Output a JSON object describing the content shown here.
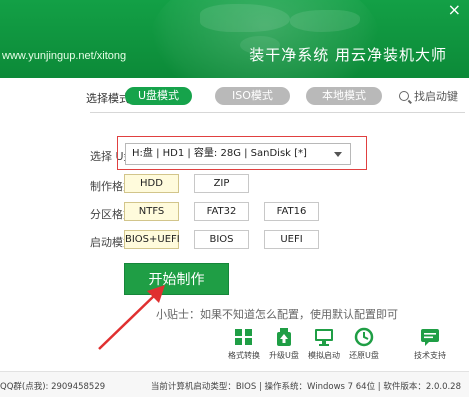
{
  "header": {
    "url": "www.yunjingup.net/xitong",
    "slogan": "装干净系统 用云净装机大师",
    "close_glyph": "×"
  },
  "mode": {
    "label": "选择模式:",
    "buttons": [
      {
        "label": "U盘模式",
        "active": true
      },
      {
        "label": "ISO模式",
        "active": false
      },
      {
        "label": "本地模式",
        "active": false
      }
    ],
    "find_drive": "找启动键"
  },
  "drive": {
    "label": "选择 U盘:",
    "value": "H:盘  |  HD1  |  容量: 28G  |  SanDisk [*]"
  },
  "format": {
    "label": "制作格式:",
    "options": [
      "HDD",
      "ZIP"
    ],
    "selected": "HDD"
  },
  "partition": {
    "label": "分区格式:",
    "options": [
      "NTFS",
      "FAT32",
      "FAT16"
    ],
    "selected": "NTFS"
  },
  "boot": {
    "label": "启动模式:",
    "options": [
      "BIOS+UEFI",
      "BIOS",
      "UEFI"
    ],
    "selected": "BIOS+UEFI"
  },
  "start_button": "开始制作",
  "tip": "小贴士：如果不知道怎么配置，使用默认配置即可",
  "tools": [
    {
      "label": "格式转换",
      "icon": "format-convert-icon"
    },
    {
      "label": "升级U盘",
      "icon": "upgrade-usb-icon"
    },
    {
      "label": "模拟启动",
      "icon": "monitor-icon"
    },
    {
      "label": "还原U盘",
      "icon": "restore-icon"
    },
    {
      "label": "技术支持",
      "icon": "chat-support-icon"
    }
  ],
  "status": {
    "left": "QQ群(点我): 2909458529",
    "right": "当前计算机启动类型：BIOS | 操作系统：Windows 7 64位 | 软件版本：2.0.0.28"
  },
  "colors": {
    "brand_green": "#13a046",
    "active_mode": "#16a34b",
    "inactive_mode": "#b9b9b9",
    "selected_option_bg": "#fffbdc",
    "highlight_border": "#e04040",
    "arrow": "#e03030"
  }
}
